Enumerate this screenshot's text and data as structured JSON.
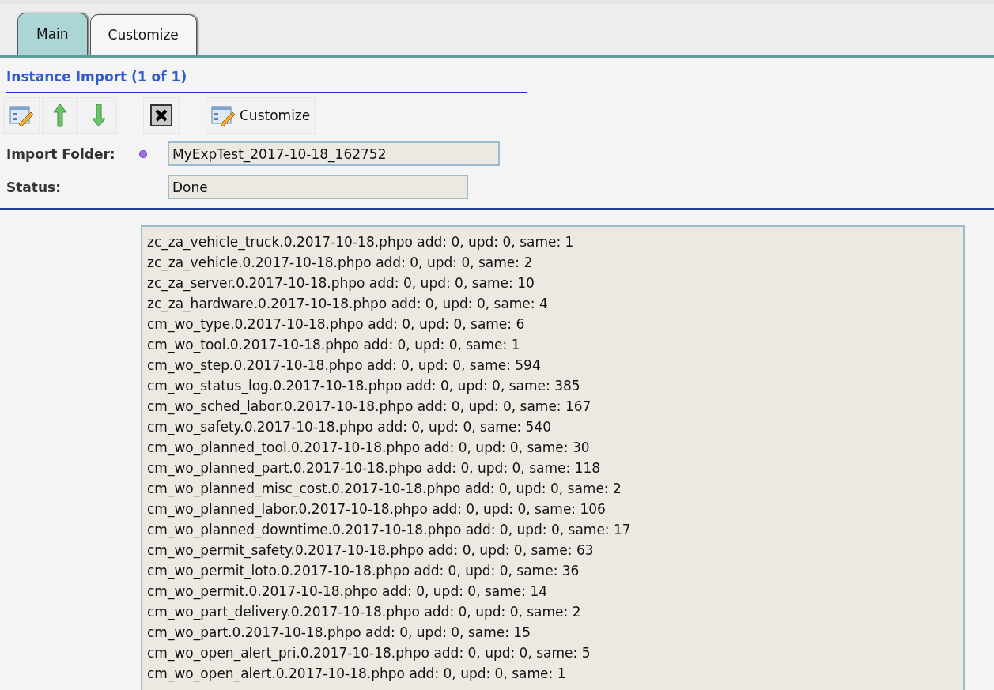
{
  "tabs": [
    {
      "label": "Main",
      "selected": true
    },
    {
      "label": "Customize",
      "selected": false
    }
  ],
  "section_title": "Instance Import (1 of 1)",
  "toolbar": {
    "customize_label": "Customize"
  },
  "fields": [
    {
      "label": "Import Folder:",
      "required": true,
      "value": "MyExpTest_2017-10-18_162752"
    },
    {
      "label": "Status:",
      "required": false,
      "value": "Done"
    }
  ],
  "log_lines": [
    "zc_za_vehicle_truck.0.2017-10-18.phpo add: 0, upd: 0, same: 1",
    "zc_za_vehicle.0.2017-10-18.phpo add: 0, upd: 0, same: 2",
    "zc_za_server.0.2017-10-18.phpo add: 0, upd: 0, same: 10",
    "zc_za_hardware.0.2017-10-18.phpo add: 0, upd: 0, same: 4",
    "cm_wo_type.0.2017-10-18.phpo add: 0, upd: 0, same: 6",
    "cm_wo_tool.0.2017-10-18.phpo add: 0, upd: 0, same: 1",
    "cm_wo_step.0.2017-10-18.phpo add: 0, upd: 0, same: 594",
    "cm_wo_status_log.0.2017-10-18.phpo add: 0, upd: 0, same: 385",
    "cm_wo_sched_labor.0.2017-10-18.phpo add: 0, upd: 0, same: 167",
    "cm_wo_safety.0.2017-10-18.phpo add: 0, upd: 0, same: 540",
    "cm_wo_planned_tool.0.2017-10-18.phpo add: 0, upd: 0, same: 30",
    "cm_wo_planned_part.0.2017-10-18.phpo add: 0, upd: 0, same: 118",
    "cm_wo_planned_misc_cost.0.2017-10-18.phpo add: 0, upd: 0, same: 2",
    "cm_wo_planned_labor.0.2017-10-18.phpo add: 0, upd: 0, same: 106",
    "cm_wo_planned_downtime.0.2017-10-18.phpo add: 0, upd: 0, same: 17",
    "cm_wo_permit_safety.0.2017-10-18.phpo add: 0, upd: 0, same: 63",
    "cm_wo_permit_loto.0.2017-10-18.phpo add: 0, upd: 0, same: 36",
    "cm_wo_permit.0.2017-10-18.phpo add: 0, upd: 0, same: 14",
    "cm_wo_part_delivery.0.2017-10-18.phpo add: 0, upd: 0, same: 2",
    "cm_wo_part.0.2017-10-18.phpo add: 0, upd: 0, same: 15",
    "cm_wo_open_alert_pri.0.2017-10-18.phpo add: 0, upd: 0, same: 5",
    "cm_wo_open_alert.0.2017-10-18.phpo add: 0, upd: 0, same: 1"
  ]
}
